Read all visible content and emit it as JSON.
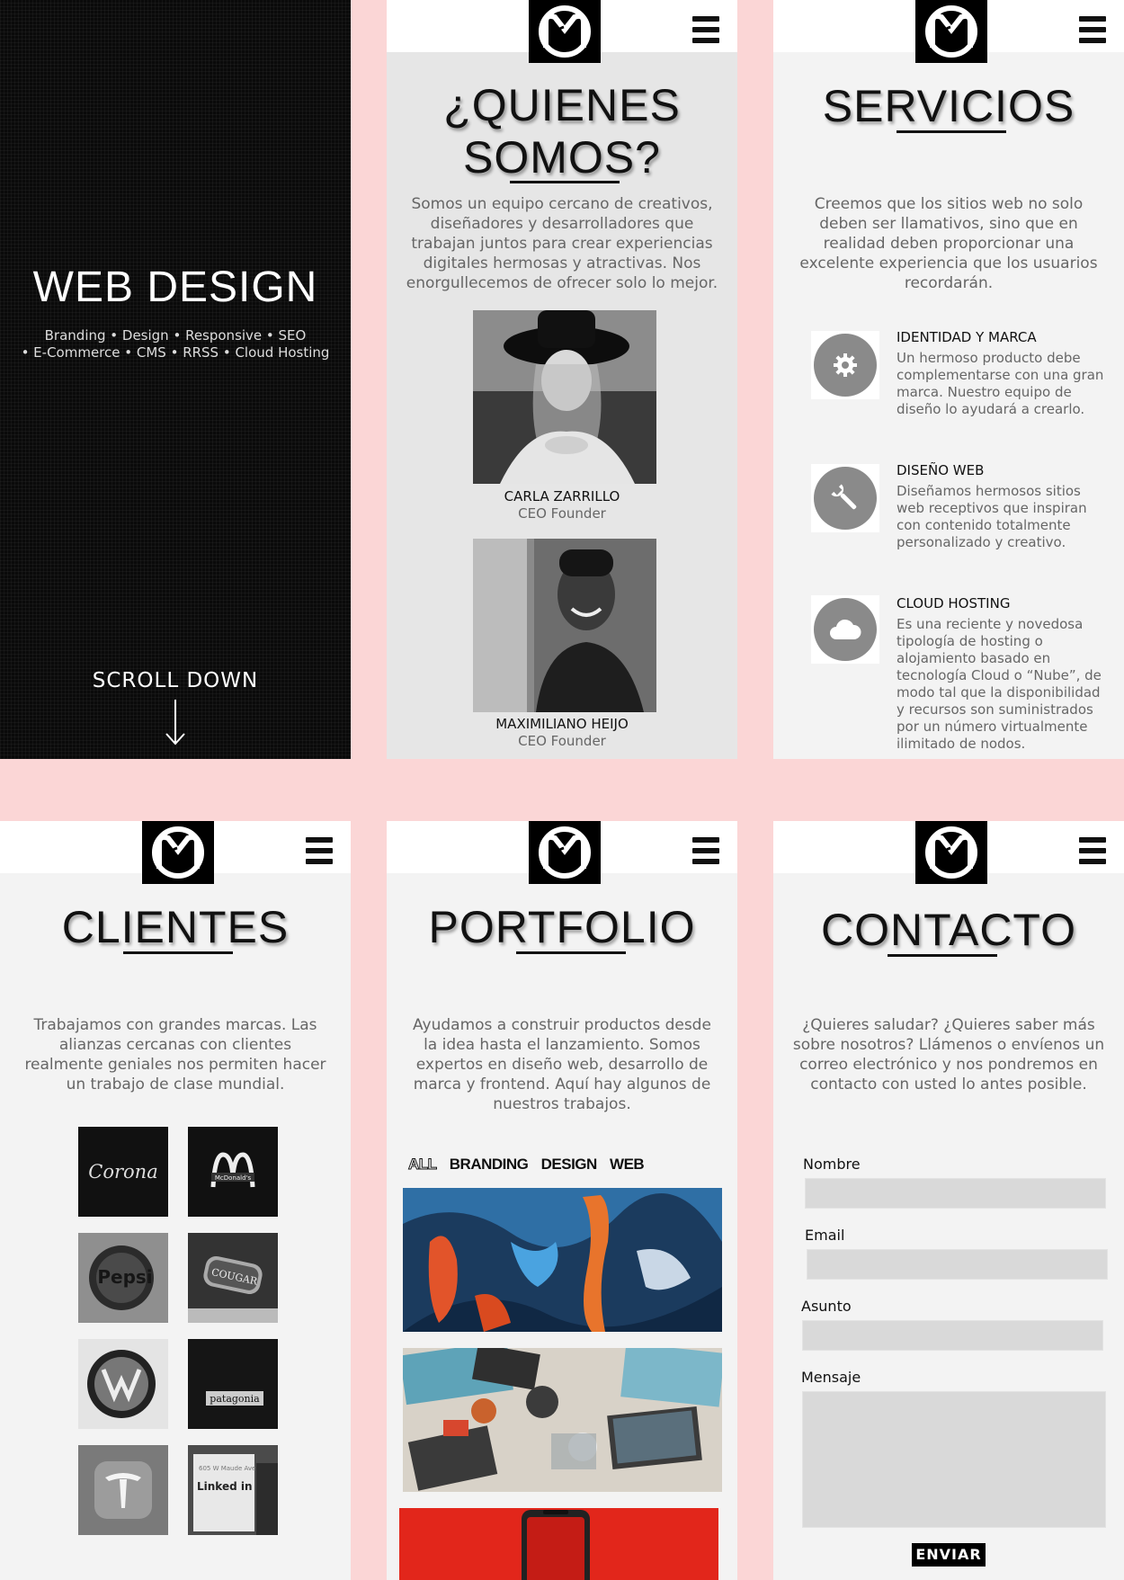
{
  "hero": {
    "title": "WEB DESIGN",
    "subtitle_line1": "Branding • Design • Responsive • SEO",
    "subtitle_line2": "• E-Commerce • CMS • RRSS • Cloud Hosting",
    "scroll_label": "SCROLL DOWN"
  },
  "about": {
    "title_line1": "¿QUIENES",
    "title_line2": "SOMOS?",
    "text": "Somos un equipo cercano de creativos, diseñadores y desarrolladores que trabajan juntos para crear experiencias digitales hermosas y atractivas. Nos enorgullecemos de ofrecer solo lo mejor.",
    "members": [
      {
        "name": "CARLA ZARRILLO",
        "role": "CEO Founder"
      },
      {
        "name": "MAXIMILIANO HEIJO",
        "role": "CEO Founder"
      }
    ]
  },
  "services": {
    "title": "SERVICIOS",
    "text": "Creemos que los sitios web no solo deben ser llamativos, sino que en realidad deben proporcionar una excelente experiencia que los usuarios recordarán.",
    "items": [
      {
        "title": "IDENTIDAD Y MARCA",
        "desc": "Un hermoso producto debe complementarse con una gran marca. Nuestro equipo de diseño lo ayudará a crearlo.",
        "icon": "gear-icon"
      },
      {
        "title": "DISEÑO WEB",
        "desc": "Diseñamos hermosos sitios web receptivos que inspiran con contenido totalmente personalizado y creativo.",
        "icon": "wrench-icon"
      },
      {
        "title": "CLOUD HOSTING",
        "desc": "Es una reciente y novedosa tipología de hosting o alojamiento basado en tecnología Cloud o “Nube”, de modo tal que la disponibilidad y recursos son suministrados por un número virtualmente ilimitado de nodos.",
        "icon": "cloud-icon"
      }
    ]
  },
  "clients": {
    "title": "CLIENTES",
    "text": "Trabajamos con grandes marcas. Las alianzas cercanas con clientes realmente geniales nos permiten hacer un trabajo de clase mundial.",
    "logos": [
      "Corona",
      "McDonald's",
      "Pepsi",
      "COUGAR",
      "VW",
      "patagonia",
      "Tesla",
      "Linked in"
    ],
    "logo_small_text": [
      "605 W Maude Ave"
    ]
  },
  "portfolio": {
    "title": "PORTFOLIO",
    "text": "Ayudamos a construir productos desde la idea hasta el lanzamiento. Somos expertos en diseño web, desarrollo de marca y frontend. Aquí hay algunos de nuestros trabajos.",
    "filters": [
      "ALL",
      "BRANDING",
      "DESIGN",
      "WEB"
    ]
  },
  "contact": {
    "title": "CONTACTO",
    "text": "¿Quieres saludar? ¿Quieres saber más sobre nosotros? Llámenos o envíenos un correo electrónico y nos pondremos en contacto con usted lo antes posible.",
    "labels": {
      "name": "Nombre",
      "email": "Email",
      "subject": "Asunto",
      "message": "Mensaje"
    },
    "send_label": "ENVIAR"
  },
  "colors": {
    "background": "#fbd6d6",
    "section_bg": "#f3f3f3",
    "accent": "#000000"
  }
}
